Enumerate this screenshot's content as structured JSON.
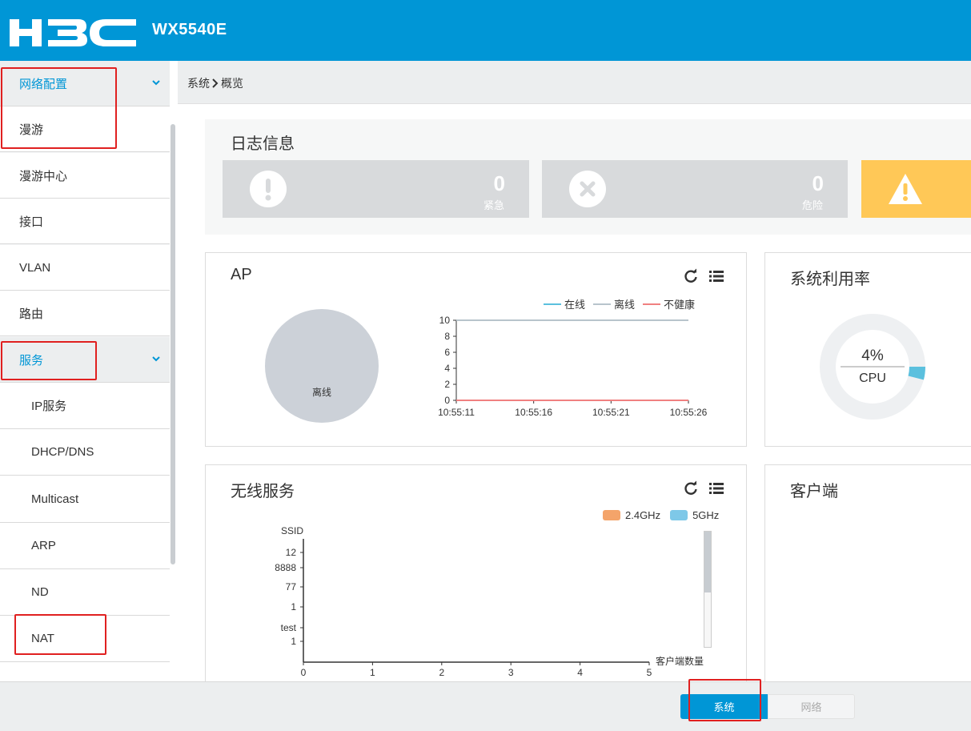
{
  "header": {
    "logo_text": "H3C",
    "model": "WX5540E"
  },
  "sidebar": {
    "items": [
      {
        "label": "网络配置",
        "type": "group"
      },
      {
        "label": "漫游",
        "type": "item"
      },
      {
        "label": "漫游中心",
        "type": "item"
      },
      {
        "label": "接口",
        "type": "item"
      },
      {
        "label": "VLAN",
        "type": "item"
      },
      {
        "label": "路由",
        "type": "item"
      },
      {
        "label": "服务",
        "type": "group"
      },
      {
        "label": "IP服务",
        "type": "sub"
      },
      {
        "label": "DHCP/DNS",
        "type": "sub"
      },
      {
        "label": "Multicast",
        "type": "sub"
      },
      {
        "label": "ARP",
        "type": "sub"
      },
      {
        "label": "ND",
        "type": "sub"
      },
      {
        "label": "NAT",
        "type": "sub"
      }
    ]
  },
  "breadcrumb": {
    "root": "系统",
    "separator": "›",
    "current": "概览"
  },
  "log_panel": {
    "title": "日志信息",
    "cards": [
      {
        "count": "0",
        "label": "紧急",
        "icon": "exclamation-circle-icon"
      },
      {
        "count": "0",
        "label": "危险",
        "icon": "x-circle-icon"
      },
      {
        "count": "",
        "label": "",
        "icon": "warning-triangle-icon"
      }
    ]
  },
  "ap_panel": {
    "title": "AP",
    "pie_label": "离线",
    "legend": [
      {
        "name": "在线",
        "color": "#5bc0de"
      },
      {
        "name": "离线",
        "color": "#b8c4cc"
      },
      {
        "name": "不健康",
        "color": "#f08080"
      }
    ]
  },
  "sys_panel": {
    "title": "系统利用率",
    "value": "4%",
    "label": "CPU",
    "percent": 4
  },
  "wireless_panel": {
    "title": "无线服务",
    "legend": [
      {
        "name": "2.4GHz",
        "color": "#f4a46a"
      },
      {
        "name": "5GHz",
        "color": "#7ec8e8"
      }
    ],
    "y_title": "SSID",
    "x_title": "客户端数量"
  },
  "client_panel": {
    "title": "客户端"
  },
  "bottom_tabs": {
    "system": "系统",
    "network": "网络"
  },
  "chart_data": [
    {
      "type": "pie",
      "labels": [
        "离线"
      ],
      "values": [
        1
      ],
      "colors": [
        "#ccd1d8"
      ]
    },
    {
      "type": "line",
      "x": [
        "10:55:11",
        "10:55:16",
        "10:55:21",
        "10:55:26"
      ],
      "ylim": [
        0,
        10
      ],
      "yticks": [
        0,
        2,
        4,
        6,
        8,
        10
      ],
      "series": [
        {
          "name": "在线",
          "values": [
            0,
            0,
            0,
            0
          ]
        },
        {
          "name": "离线",
          "values": [
            10,
            10,
            10,
            10
          ]
        },
        {
          "name": "不健康",
          "values": [
            0,
            0,
            0,
            0
          ]
        }
      ]
    },
    {
      "type": "bar",
      "orientation": "horizontal",
      "categories": [
        "12",
        "8888",
        "77",
        "1",
        "test",
        "1"
      ],
      "xlim": [
        0,
        5
      ],
      "xticks": [
        0,
        1,
        2,
        3,
        4,
        5
      ],
      "ylabel": "SSID",
      "xlabel": "客户端数量",
      "series": [
        {
          "name": "2.4GHz",
          "values": [
            0,
            0,
            0,
            0,
            0,
            0
          ]
        },
        {
          "name": "5GHz",
          "values": [
            0,
            0,
            0,
            0,
            0,
            0
          ]
        }
      ]
    }
  ]
}
